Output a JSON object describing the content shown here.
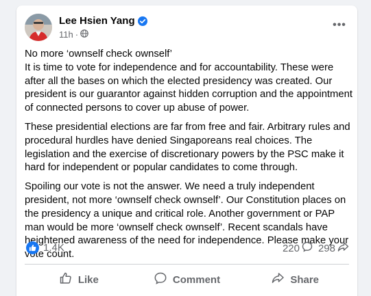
{
  "post": {
    "author": "Lee Hsien Yang",
    "time": "11h",
    "visibility_icon": "globe-icon",
    "verified_icon": "verified-badge-icon",
    "more_label": "•••",
    "paragraphs": [
      "No more ‘ownself check ownself’\nIt is time to vote for independence and for accountability.  These were after all the bases on which the elected presidency was created.  Our president is our guarantor against hidden corruption and the appointment of connected persons to cover up abuse of power.",
      "These presidential elections are far from free and fair.  Arbitrary rules and procedural hurdles have denied Singaporeans real choices. The legislation and the exercise of discretionary powers by the PSC make it hard for independent or popular candidates to come through.",
      "Spoiling our vote is not the answer.   We need a truly independent president, not more ‘ownself check ownself’. Our Constitution places on the presidency a unique and critical role. Another government or PAP man would be more ‘ownself check ownself’.  Recent scandals have heightened awareness of the need for independence. Please make your vote count."
    ]
  },
  "stats": {
    "reactions": "1.4K",
    "comments": "220",
    "shares": "298"
  },
  "actions": {
    "like": "Like",
    "comment": "Comment",
    "share": "Share"
  },
  "colors": {
    "accent": "#1877f2",
    "secondary_text": "#65676b",
    "background": "#f0f2f5"
  }
}
